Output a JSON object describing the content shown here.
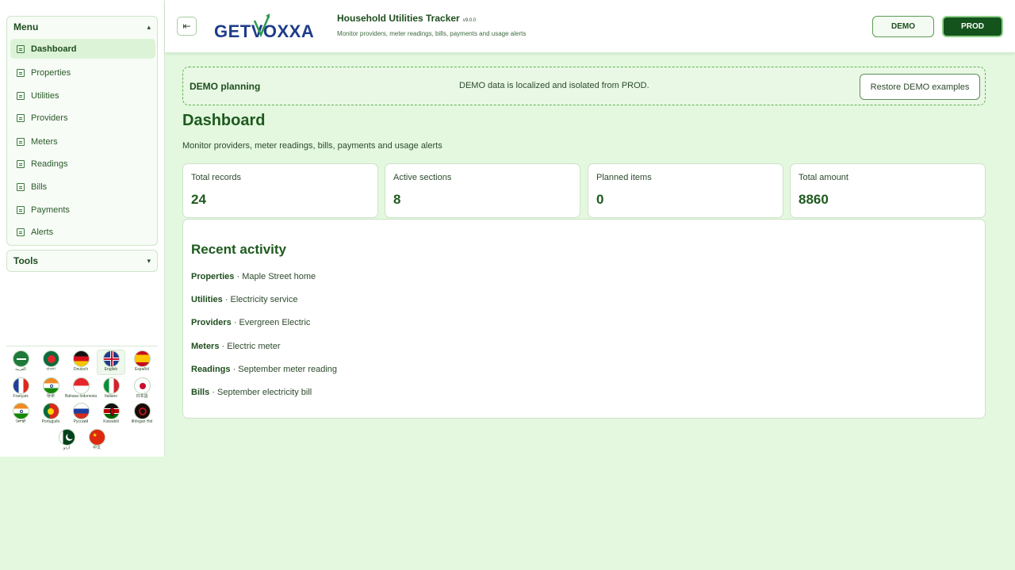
{
  "sidebar": {
    "menu_title": "Menu",
    "tools_title": "Tools",
    "items": [
      {
        "label": "Dashboard",
        "active": true
      },
      {
        "label": "Properties"
      },
      {
        "label": "Utilities"
      },
      {
        "label": "Providers"
      },
      {
        "label": "Meters"
      },
      {
        "label": "Readings"
      },
      {
        "label": "Bills"
      },
      {
        "label": "Payments"
      },
      {
        "label": "Alerts"
      }
    ],
    "languages": [
      {
        "label": "العربية",
        "icon": "flag-saudi-arabia-icon"
      },
      {
        "label": "বাংলা",
        "icon": "flag-bangladesh-icon"
      },
      {
        "label": "Deutsch",
        "icon": "flag-germany-icon"
      },
      {
        "label": "English",
        "icon": "flag-uk-icon",
        "selected": true
      },
      {
        "label": "Español",
        "icon": "flag-spain-icon"
      },
      {
        "label": "Français",
        "icon": "flag-france-icon"
      },
      {
        "label": "हिन्दी",
        "icon": "flag-india-icon"
      },
      {
        "label": "Bahasa Indonesia",
        "icon": "flag-indonesia-icon"
      },
      {
        "label": "Italiano",
        "icon": "flag-italy-icon"
      },
      {
        "label": "日本語",
        "icon": "flag-japan-icon"
      },
      {
        "label": "ਪੰਜਾਬੀ",
        "icon": "flag-india-icon"
      },
      {
        "label": "Português",
        "icon": "flag-portugal-icon"
      },
      {
        "label": "Русский",
        "icon": "flag-russia-icon"
      },
      {
        "label": "Kiswahili",
        "icon": "flag-kenya-icon"
      },
      {
        "label": "tlhIngan Hol",
        "icon": "flag-klingon-icon"
      },
      {
        "label": "اردو",
        "icon": "flag-pakistan-icon"
      },
      {
        "label": "中文",
        "icon": "flag-china-icon"
      }
    ]
  },
  "header": {
    "logo_text": "GETVOXXA",
    "title": "Household Utilities Tracker",
    "version": "v9.0.0",
    "subtitle": "Monitor providers, meter readings, bills, payments and usage alerts",
    "demo_label": "DEMO",
    "prod_label": "PROD"
  },
  "banner": {
    "title": "DEMO planning",
    "text": "DEMO data is localized and isolated from PROD.",
    "restore_label": "Restore DEMO examples"
  },
  "main": {
    "title": "Dashboard",
    "subtitle": "Monitor providers, meter readings, bills, payments and usage alerts",
    "stats": [
      {
        "label": "Total records",
        "value": "24"
      },
      {
        "label": "Active sections",
        "value": "8"
      },
      {
        "label": "Planned items",
        "value": "0"
      },
      {
        "label": "Total amount",
        "value": "8860"
      }
    ],
    "activity": {
      "title": "Recent activity",
      "items": [
        {
          "section": "Properties",
          "detail": "Maple Street home"
        },
        {
          "section": "Utilities",
          "detail": "Electricity service"
        },
        {
          "section": "Providers",
          "detail": "Evergreen Electric"
        },
        {
          "section": "Meters",
          "detail": "Electric meter"
        },
        {
          "section": "Readings",
          "detail": "September meter reading"
        },
        {
          "section": "Bills",
          "detail": "September electricity bill"
        }
      ]
    }
  },
  "colors": {
    "accent": "#1e5a1e",
    "background": "#e3f8df",
    "prod": "#14531c"
  }
}
